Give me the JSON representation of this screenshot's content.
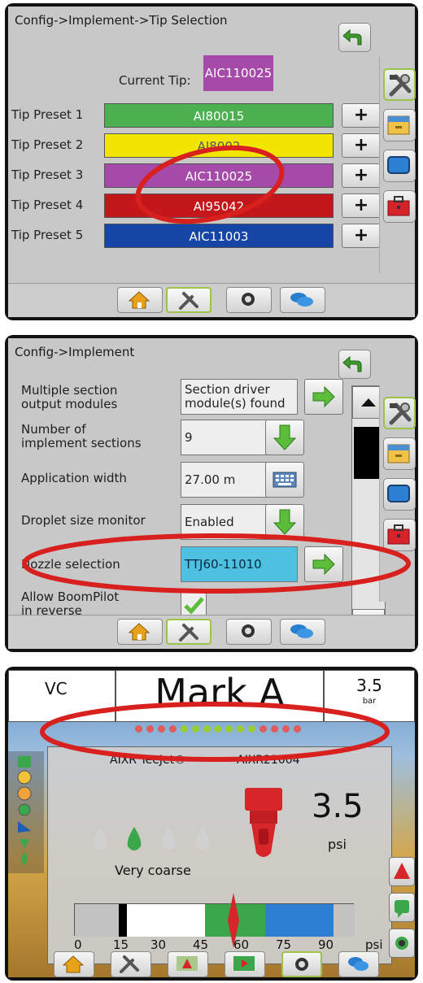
{
  "panel1": {
    "title": "Config->Implement->Tip Selection",
    "current_tip_label": "Current Tip:",
    "current_tip_value": "AIC110025",
    "presets": [
      {
        "label": "Tip Preset 1",
        "value": "AI80015",
        "color": "#4caf50"
      },
      {
        "label": "Tip Preset 2",
        "value": "AI8002",
        "color": "#f2e600"
      },
      {
        "label": "Tip Preset 3",
        "value": "AIC110025",
        "color": "#a54aa8"
      },
      {
        "label": "Tip Preset 4",
        "value": "AI95042",
        "color": "#c4171c"
      },
      {
        "label": "Tip Preset 5",
        "value": "AIC11003",
        "color": "#1546a6"
      }
    ],
    "plus_label": "+"
  },
  "panel2": {
    "title": "Config->Implement",
    "rows": [
      {
        "label_1": "Multiple section",
        "label_2": "output modules",
        "value_1": "Section driver",
        "value_2": "module(s) found"
      },
      {
        "label_1": "Number of",
        "label_2": "implement sections",
        "value_1": "9",
        "value_2": ""
      },
      {
        "label_1": "Application width",
        "label_2": "",
        "value_1": "27.00 m",
        "value_2": ""
      },
      {
        "label_1": "Droplet size monitor",
        "label_2": "",
        "value_1": "Enabled",
        "value_2": ""
      },
      {
        "label_1": "Nozzle selection",
        "label_2": "",
        "value_1": "TTJ60-11010",
        "value_2": ""
      },
      {
        "label_1": "Allow BoomPilot",
        "label_2": "in reverse",
        "value_1": "",
        "value_2": ""
      }
    ]
  },
  "panel3": {
    "mode": "VC",
    "heading": "Mark A",
    "pressure_top": "3.5",
    "pressure_top_unit": "bar",
    "nozzle_brand": "AIXR TeeJet®",
    "nozzle_model": "AIXR21004",
    "pressure_value": "3.5",
    "pressure_unit": "psi",
    "droplet_label": "Very coarse",
    "gauge_ticks": [
      "0",
      "15",
      "30",
      "45",
      "60",
      "75",
      "90"
    ],
    "gauge_unit": "psi",
    "gauge_needle_psi": 60
  },
  "colors": {
    "accent_green": "#4caf50",
    "highlight_red": "#d8201e",
    "nozzle_field": "#4ec1e2"
  }
}
